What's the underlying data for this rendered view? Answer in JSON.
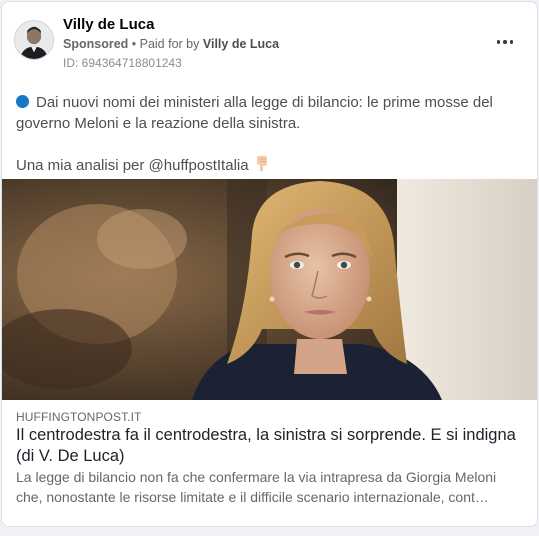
{
  "post": {
    "author": "Villy de Luca",
    "sponsored": "Sponsored",
    "paid_for_prefix": " • Paid for by ",
    "paid_for_by": "Villy de Luca",
    "ad_id": "ID: 694364718801243",
    "more_icon": "more-horizontal-icon",
    "text_line1": "Dai nuovi nomi dei ministeri alla legge di bilancio: le prime mosse del governo Meloni e la reazione della sinistra.",
    "text_line2": "Una mia analisi per @huffpostItalia"
  },
  "link": {
    "domain": "HUFFINGTONPOST.IT",
    "headline": "Il centrodestra fa il centrodestra, la sinistra si sorprende. E si indigna (di V. De Luca)",
    "description": "La legge di bilancio non fa che confermare la via intrapresa da Giorgia Meloni che, nonostante le risorse limitate e il difficile scenario internazionale, cont…"
  },
  "colors": {
    "blue_dot": "#1877c9",
    "text_secondary": "#65676b"
  }
}
